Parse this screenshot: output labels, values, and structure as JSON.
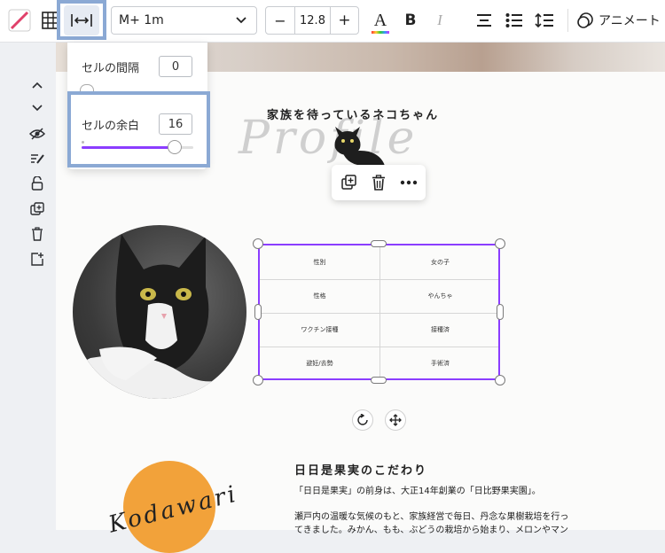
{
  "toolbar": {
    "font_name": "M+ 1m",
    "font_size": "12.8",
    "minus": "−",
    "plus": "+",
    "text_color_letter": "A",
    "bold": "B",
    "italic": "I",
    "animate_label": "アニメート"
  },
  "spacing_panel": {
    "cell_spacing_label": "セルの間隔",
    "cell_spacing_value": "0",
    "cell_padding_label": "セルの余白",
    "cell_padding_value": "16",
    "cell_padding_slider_fraction": 0.83
  },
  "design": {
    "profile_heading": "家族を待っているネコちゃん",
    "profile_script": "Profile",
    "table": [
      [
        "性別",
        "女の子"
      ],
      [
        "性格",
        "やんちゃ"
      ],
      [
        "ワクチン接種",
        "接種済"
      ],
      [
        "避妊/去勢",
        "手術済"
      ]
    ],
    "kodawari_script": "Kodawari",
    "section_title": "日日是果実のこだわり",
    "para1": "「日日是果実」の前身は、大正14年創業の「日比野果実園」。",
    "para2a": "瀬戸内の温暖な気候のもと、家族経営で毎日、丹念な果樹栽培を行っ",
    "para2b": "てきました。みかん、もも、ぶどうの栽培から始まり、メロンやマン"
  },
  "colors": {
    "accent": "#8b3dff",
    "highlight": "#8ba9d4",
    "orange": "#f2a23a"
  }
}
